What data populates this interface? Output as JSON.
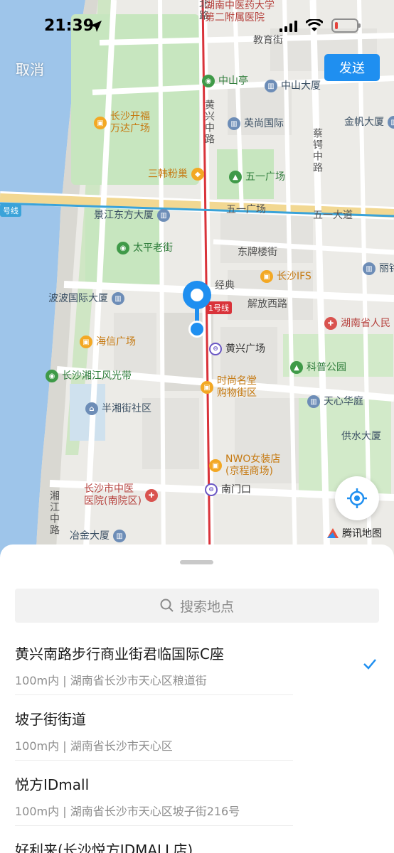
{
  "status_bar": {
    "time": "21:39"
  },
  "header": {
    "cancel": "取消",
    "send": "发送"
  },
  "map": {
    "pois": {
      "hunan_tcm": "湖南中医药大学",
      "hunan_tcm2": "第二附属医院",
      "zhongshan_pav": "中山亭",
      "zhongshan_bldg": "中山大厦",
      "wanda_1": "长沙开福",
      "wanda_2": "万达广场",
      "yingshang": "英尚国际",
      "jinfan": "金帆大厦",
      "sanhan": "三韩粉巢",
      "wuyi_square": "五一广场",
      "jingjiang": "景江东方大厦",
      "taiping": "太平老街",
      "ifs": "长沙IFS",
      "jingdian": "经典",
      "bobo": "波波国际大厦",
      "haixin": "海信广场",
      "huangxing_sq": "黄兴广场",
      "hunan_renmin": "湖南省人民",
      "kepu": "科普公园",
      "xiangjiang_band": "长沙湘江风光带",
      "shishang_1": "时尚名堂",
      "shishang_2": "购物街区",
      "banxiang": "半湘街社区",
      "tianxin": "天心华庭",
      "gongshui": "供水大厦",
      "nwo_1": "NWO女装店",
      "nwo_2": "(京程商场)",
      "tcm_hosp_1": "长沙市中医",
      "tcm_hosp_2": "医院(南院区)",
      "nanmenkou": "南门口",
      "yejin": "冶金大厦",
      "lijia": "丽铭"
    },
    "roads": {
      "jiaoyu": "教育街",
      "huangxing_n": "黄兴中路",
      "caie": "蔡锷中路",
      "wuyi_square_road": "五一广场",
      "wuyi_ave": "五一大道",
      "dongpailou": "东牌楼街",
      "jiefang_w": "解放西路",
      "xiangjiang_rd": "湘江中路",
      "north_road": "北路"
    },
    "line_badge_1": "1号线",
    "line_badge_2": "号线",
    "brand": "腾讯地图",
    "colors": {
      "river": "#9ec5ea",
      "park": "#c7e6bf",
      "metro_red": "#d9333a",
      "metro_blue": "#3aa3d9",
      "marker": "#1f8ff0"
    }
  },
  "sheet": {
    "search_placeholder": "搜索地点",
    "results": [
      {
        "title": "黄兴南路步行商业街君临国际C座",
        "subtitle": "100m内 | 湖南省长沙市天心区粮道街",
        "selected": true
      },
      {
        "title": "坡子街街道",
        "subtitle": "100m内 | 湖南省长沙市天心区",
        "selected": false
      },
      {
        "title": "悦方IDmall",
        "subtitle": "100m内 | 湖南省长沙市天心区坡子街216号",
        "selected": false
      },
      {
        "title": "好利来(长沙悦方IDMALL店)",
        "subtitle": "",
        "selected": false
      }
    ]
  }
}
